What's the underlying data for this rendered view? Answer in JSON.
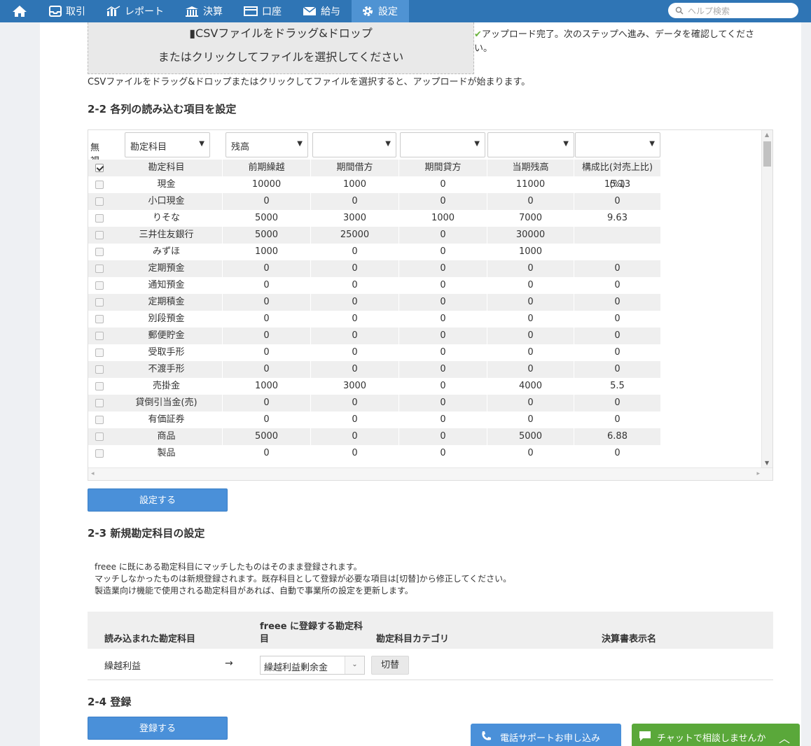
{
  "nav": {
    "items": [
      {
        "label": "取引",
        "icon": "inbox-icon"
      },
      {
        "label": "レポート",
        "icon": "chart-icon"
      },
      {
        "label": "決算",
        "icon": "building-icon"
      },
      {
        "label": "口座",
        "icon": "wallet-icon"
      },
      {
        "label": "給与",
        "icon": "envelope-icon"
      },
      {
        "label": "設定",
        "icon": "gear-icon"
      }
    ],
    "active": "設定",
    "search_placeholder": "ヘルプ検索",
    "colors": {
      "bar": "#2f75b5",
      "active": "#4f93d3"
    }
  },
  "upload": {
    "drop_line1": "CSVファイルをドラッグ&ドロップ",
    "drop_line2": "またはクリックしてファイルを選択してください",
    "complete_msg": "アップロード完了。次のステップへ進み、データを確認してください。",
    "hint": "CSVファイルをドラッグ&ドロップまたはクリックしてファイルを選択すると、アップロードが始まります。"
  },
  "section22": {
    "title": "2-2 各列の読み込む項目を設定",
    "ignore_label": "無視",
    "selects": [
      "勘定科目",
      "残高",
      "",
      "",
      "",
      ""
    ],
    "headers": [
      "勘定科目",
      "前期繰越",
      "期間借方",
      "期間貸方",
      "当期残高",
      "構成比(対売上比)(%)"
    ],
    "rows": [
      [
        "現金",
        "10000",
        "1000",
        "0",
        "11000",
        "15.13"
      ],
      [
        "小口現金",
        "0",
        "0",
        "0",
        "0",
        "0"
      ],
      [
        "りそな",
        "5000",
        "3000",
        "1000",
        "7000",
        "9.63"
      ],
      [
        "三井住友銀行",
        "5000",
        "25000",
        "0",
        "30000",
        ""
      ],
      [
        "みずほ",
        "1000",
        "0",
        "0",
        "1000",
        ""
      ],
      [
        "定期預金",
        "0",
        "0",
        "0",
        "0",
        "0"
      ],
      [
        "通知預金",
        "0",
        "0",
        "0",
        "0",
        "0"
      ],
      [
        "定期積金",
        "0",
        "0",
        "0",
        "0",
        "0"
      ],
      [
        "別段預金",
        "0",
        "0",
        "0",
        "0",
        "0"
      ],
      [
        "郵便貯金",
        "0",
        "0",
        "0",
        "0",
        "0"
      ],
      [
        "受取手形",
        "0",
        "0",
        "0",
        "0",
        "0"
      ],
      [
        "不渡手形",
        "0",
        "0",
        "0",
        "0",
        "0"
      ],
      [
        "売掛金",
        "1000",
        "3000",
        "0",
        "4000",
        "5.5"
      ],
      [
        "貸倒引当金(売)",
        "0",
        "0",
        "0",
        "0",
        "0"
      ],
      [
        "有価証券",
        "0",
        "0",
        "0",
        "0",
        "0"
      ],
      [
        "商品",
        "5000",
        "0",
        "0",
        "5000",
        "6.88"
      ],
      [
        "製品",
        "0",
        "0",
        "0",
        "0",
        "0"
      ]
    ],
    "set_button": "設定する"
  },
  "section23": {
    "title": "2-3 新規勘定科目の設定",
    "desc": [
      "freee に既にある勘定科目にマッチしたものはそのまま登録されます。",
      "マッチしなかったものは新規登録されます。既存科目として登録が必要な項目は[切替]から修正してください。",
      "製造業向け機能で使用される勘定科目があれば、自動で事業所の設定を更新します。"
    ],
    "headers": {
      "imported": "読み込まれた勘定科目",
      "freee_line1": "freee に登録する勘定科",
      "freee_line2": "目",
      "category": "勘定科目カテゴリ",
      "display": "決算書表示名"
    },
    "row": {
      "imported": "繰越利益",
      "arrow": "→",
      "select": "繰越利益剰余金",
      "switch": "切替"
    }
  },
  "section24": {
    "title": "2-4 登録",
    "button": "登録する"
  },
  "support": {
    "phone": "電話サポートお申し込み",
    "chat": "チャットで相談しませんか"
  }
}
